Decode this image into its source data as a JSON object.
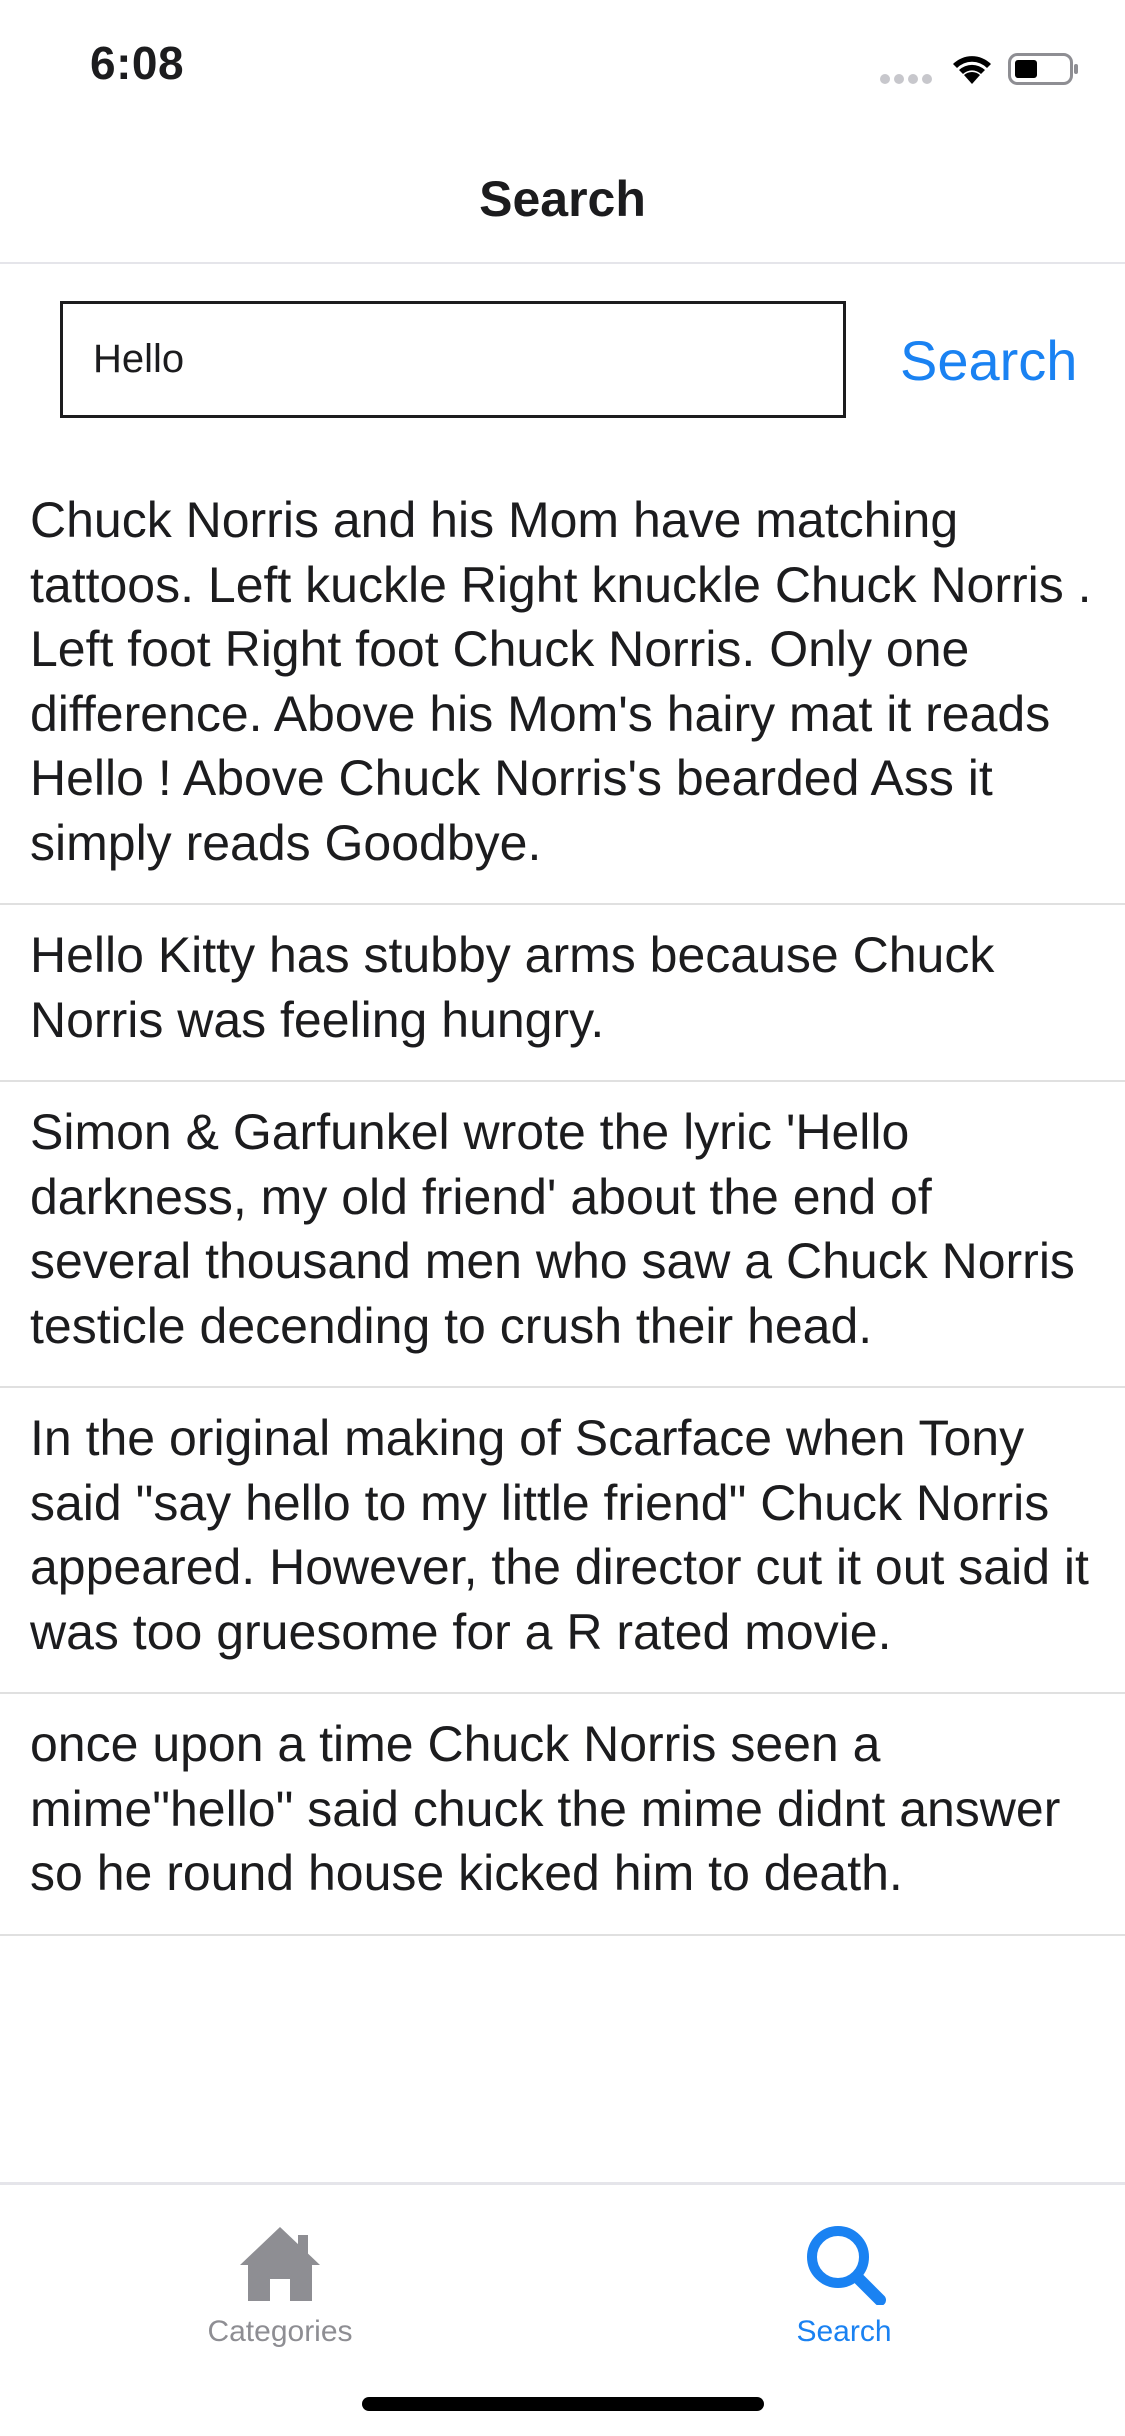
{
  "status_bar": {
    "time": "6:08",
    "icons": [
      "signal-icon",
      "wifi-icon",
      "battery-icon"
    ]
  },
  "nav": {
    "title": "Search"
  },
  "search": {
    "value": "Hello",
    "button_label": "Search"
  },
  "results": [
    "Chuck Norris and his Mom have matching tattoos. Left kuckle Right knuckle Chuck Norris . Left foot Right foot Chuck Norris. Only one difference. Above his Mom's hairy mat it reads Hello ! Above Chuck Norris's bearded Ass it simply reads Goodbye.",
    "Hello Kitty has stubby arms because Chuck Norris was feeling hungry.",
    "Simon & Garfunkel wrote the lyric 'Hello darkness, my old friend' about the end of several thousand men who saw a Chuck Norris testicle decending to crush their head.",
    "In the original making of Scarface when Tony said \"say hello to my little friend\" Chuck Norris appeared. However, the director cut it out said it was too gruesome for a R rated movie.",
    "once upon a time Chuck Norris seen a mime\"hello\" said chuck the mime didnt answer so he round house kicked him to death."
  ],
  "tab_bar": {
    "tabs": [
      {
        "label": "Categories",
        "icon": "home-icon",
        "active": false
      },
      {
        "label": "Search",
        "icon": "search-icon",
        "active": true
      }
    ]
  },
  "colors": {
    "accent": "#1a82f2",
    "inactive_tab": "#8e8e93",
    "separator": "#e0e0e0"
  }
}
